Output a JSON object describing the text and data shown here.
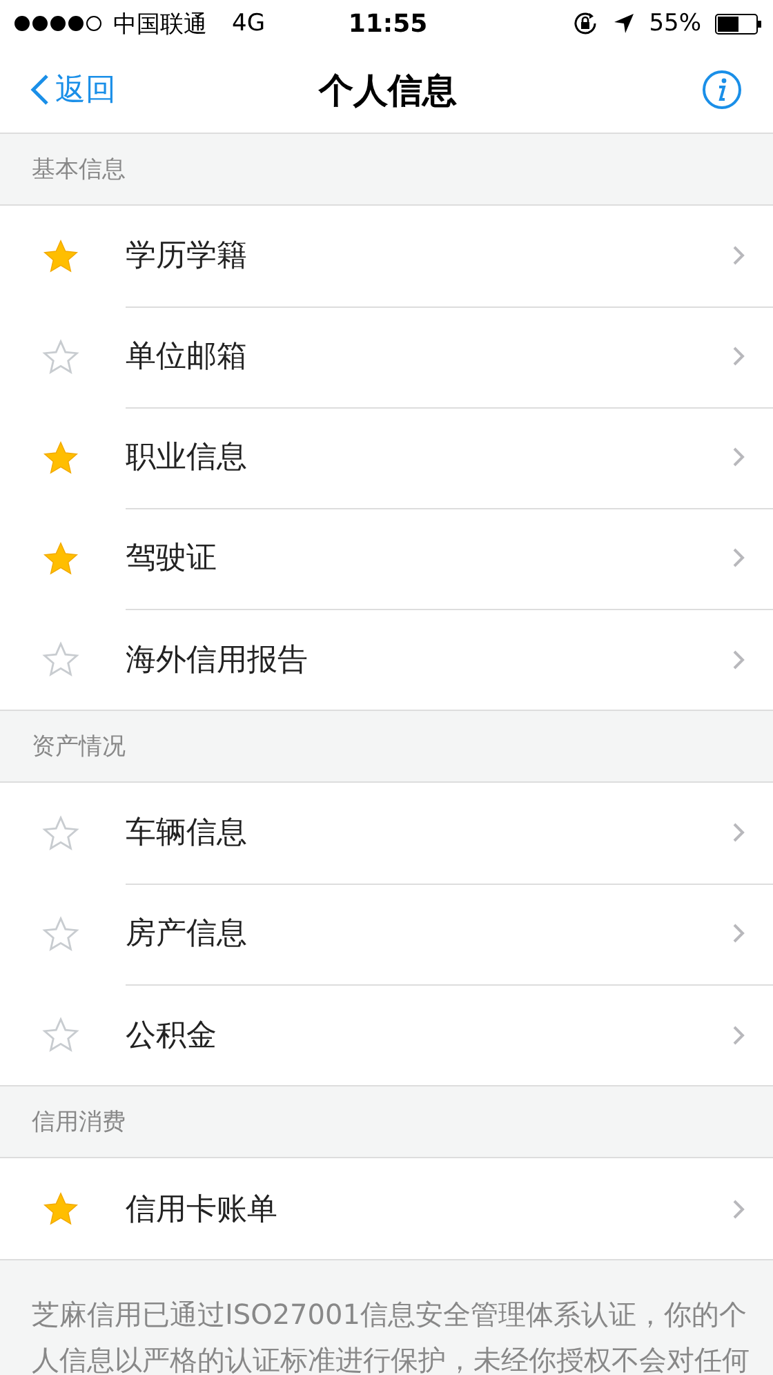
{
  "status_bar": {
    "carrier": "中国联通",
    "network": "4G",
    "time": "11:55",
    "battery": "55%"
  },
  "nav": {
    "back": "返回",
    "title": "个人信息"
  },
  "sections": [
    {
      "title": "基本信息",
      "items": [
        {
          "label": "学历学籍",
          "starred": true
        },
        {
          "label": "单位邮箱",
          "starred": false
        },
        {
          "label": "职业信息",
          "starred": true
        },
        {
          "label": "驾驶证",
          "starred": true
        },
        {
          "label": "海外信用报告",
          "starred": false
        }
      ]
    },
    {
      "title": "资产情况",
      "items": [
        {
          "label": "车辆信息",
          "starred": false
        },
        {
          "label": "房产信息",
          "starred": false
        },
        {
          "label": "公积金",
          "starred": false
        }
      ]
    },
    {
      "title": "信用消费",
      "items": [
        {
          "label": "信用卡账单",
          "starred": true
        }
      ]
    }
  ],
  "footer": {
    "lines": [
      "芝麻信用已通过ISO27001信息安全管理体系认证，你的个",
      "人信息以严格的认证标准进行保护，未经你授权不会对任何"
    ]
  }
}
